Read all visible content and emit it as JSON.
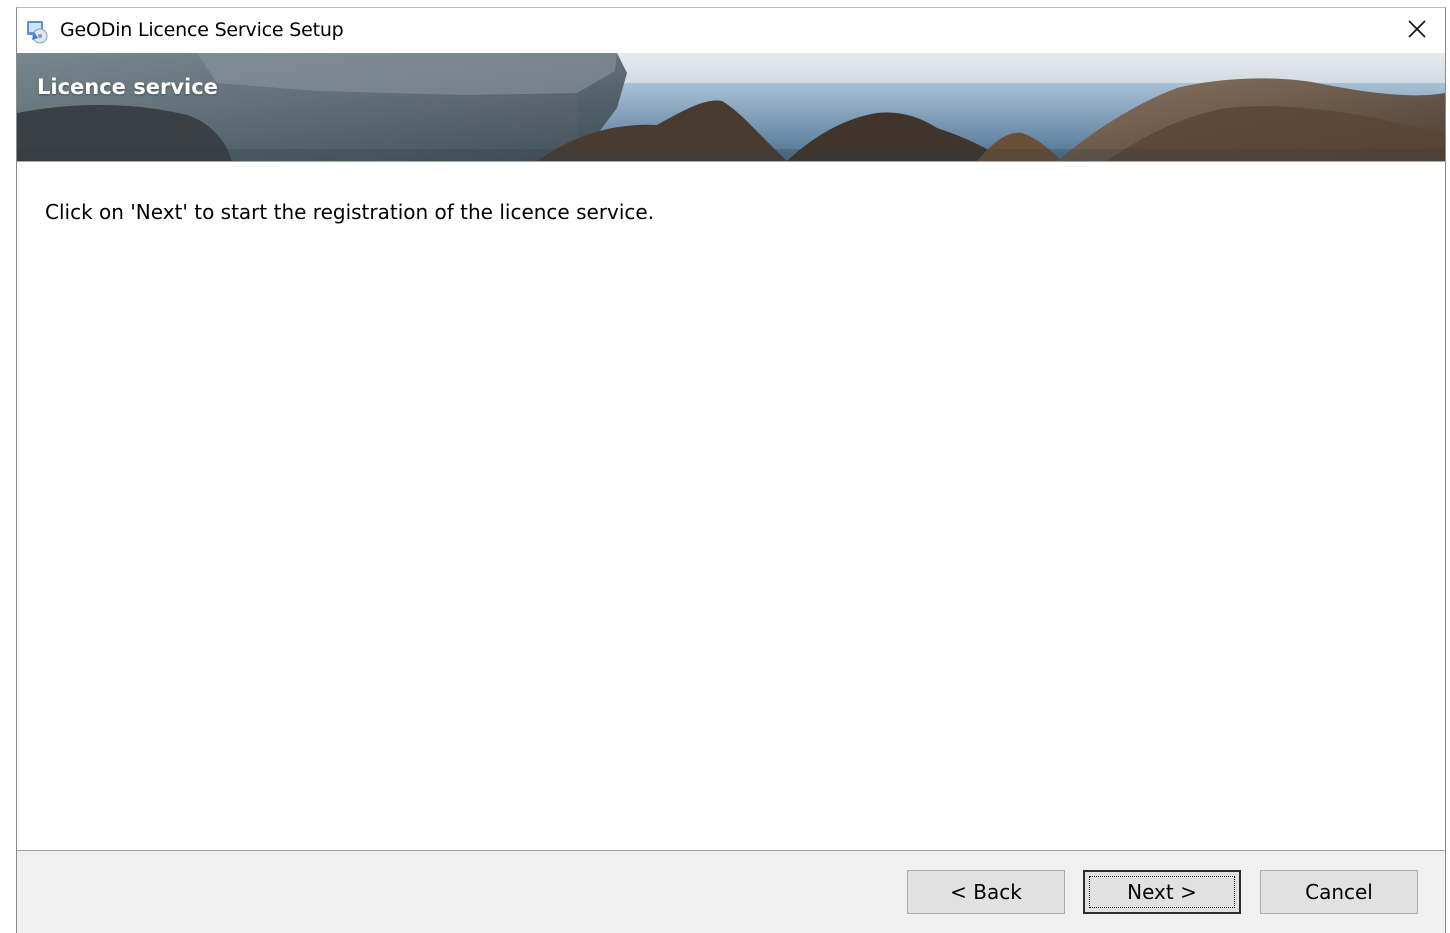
{
  "window": {
    "title": "GeODin Licence Service Setup"
  },
  "banner": {
    "title": "Licence service"
  },
  "content": {
    "instruction": "Click on 'Next' to start the registration of the licence service."
  },
  "buttons": {
    "back": "< Back",
    "next": "Next >",
    "cancel": "Cancel"
  },
  "icons": {
    "app": "setup-installer-icon",
    "close": "close-icon"
  }
}
